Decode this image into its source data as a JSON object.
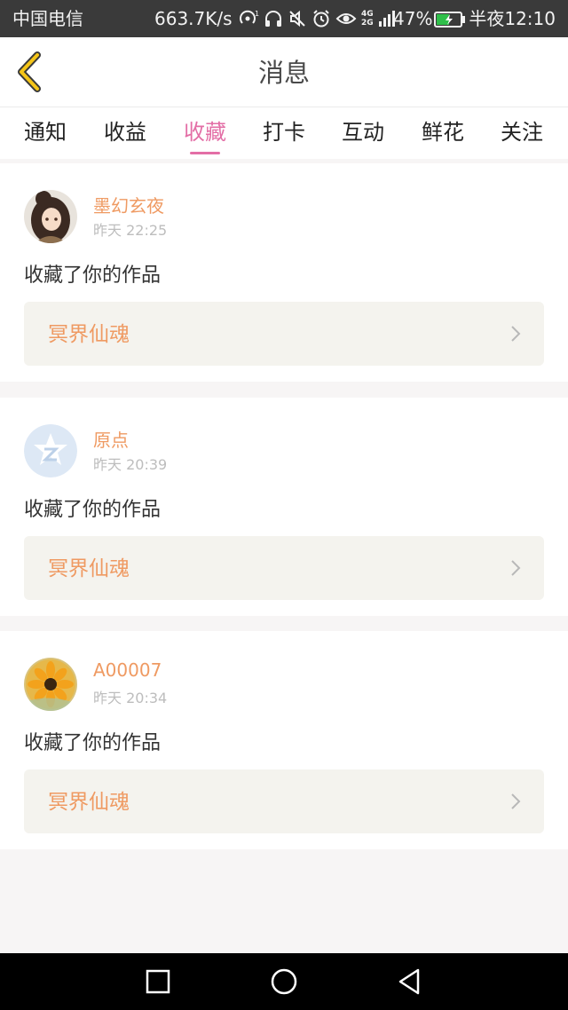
{
  "status_bar": {
    "carrier": "中国电信",
    "speed": "663.7K/s",
    "network_labels": [
      "4G",
      "2G"
    ],
    "battery": "47%",
    "time": "半夜12:10"
  },
  "header": {
    "title": "消息",
    "back_icon": "chevron-left-icon"
  },
  "tabs": [
    {
      "label": "通知",
      "active": false
    },
    {
      "label": "收益",
      "active": false
    },
    {
      "label": "收藏",
      "active": true
    },
    {
      "label": "打卡",
      "active": false
    },
    {
      "label": "互动",
      "active": false
    },
    {
      "label": "鲜花",
      "active": false
    },
    {
      "label": "关注",
      "active": false
    }
  ],
  "notifications": [
    {
      "username": "墨幻玄夜",
      "time": "昨天 22:25",
      "action": "收藏了你的作品",
      "work_title": "冥界仙魂",
      "avatar": "anime-girl-avatar"
    },
    {
      "username": "原点",
      "time": "昨天 20:39",
      "action": "收藏了你的作品",
      "work_title": "冥界仙魂",
      "avatar": "default-qq-avatar"
    },
    {
      "username": "A00007",
      "time": "昨天 20:34",
      "action": "收藏了你的作品",
      "work_title": "冥界仙魂",
      "avatar": "sunflower-avatar"
    }
  ],
  "colors": {
    "accent_pink": "#e36ea6",
    "orange_text": "#ef9a62",
    "card_bg": "#f4f3ee",
    "page_bg": "#f7f5f5"
  },
  "nav_bar": {
    "icons": [
      "recent-apps-icon",
      "home-icon",
      "back-triangle-icon"
    ]
  }
}
